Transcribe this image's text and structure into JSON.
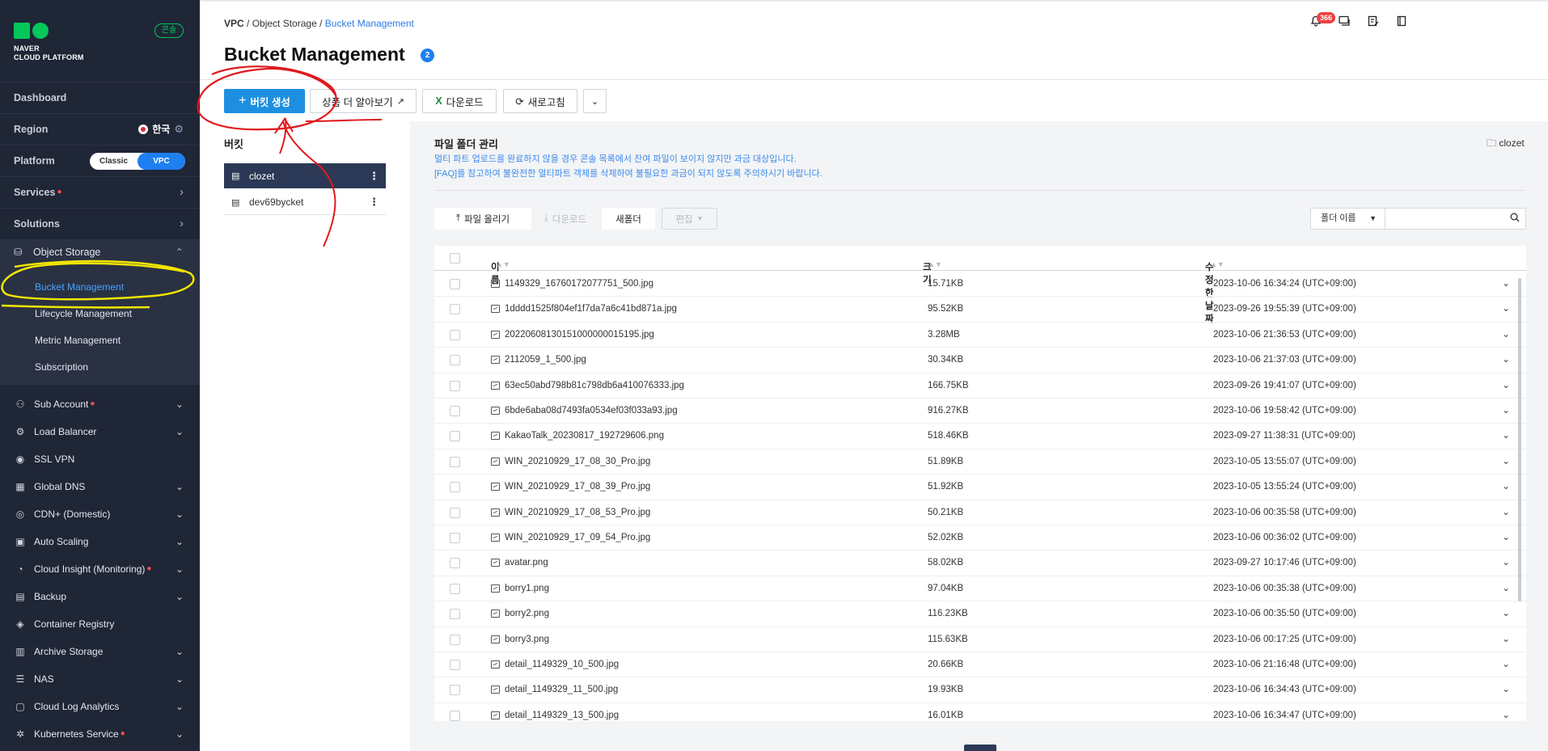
{
  "brand": {
    "line1": "NAVER",
    "line2": "CLOUD PLATFORM",
    "console_badge": "콘솔",
    "accent": "#03c75a"
  },
  "sidebar": {
    "dashboard": "Dashboard",
    "region_label": "Region",
    "region_value": "한국",
    "platform_label": "Platform",
    "platform_options": [
      "Classic",
      "VPC"
    ],
    "platform_selected": "VPC",
    "services": "Services",
    "solutions": "Solutions",
    "object_storage": "Object Storage",
    "object_storage_items": [
      "Bucket Management",
      "Lifecycle Management",
      "Metric Management",
      "Subscription"
    ],
    "active_item": "Bucket Management",
    "products": [
      {
        "label": "Sub Account",
        "icon": "users-icon",
        "dot": true,
        "expand": true
      },
      {
        "label": "Load Balancer",
        "icon": "load-balancer-icon",
        "dot": false,
        "expand": true
      },
      {
        "label": "SSL VPN",
        "icon": "vpn-icon",
        "dot": false,
        "expand": false
      },
      {
        "label": "Global DNS",
        "icon": "dns-icon",
        "dot": false,
        "expand": true
      },
      {
        "label": "CDN+ (Domestic)",
        "icon": "cdn-icon",
        "dot": false,
        "expand": true
      },
      {
        "label": "Auto Scaling",
        "icon": "auto-scaling-icon",
        "dot": false,
        "expand": true
      },
      {
        "label": "Cloud Insight (Monitoring)",
        "icon": "monitoring-icon",
        "dot": true,
        "expand": true
      },
      {
        "label": "Backup",
        "icon": "backup-icon",
        "dot": false,
        "expand": true
      },
      {
        "label": "Container Registry",
        "icon": "registry-icon",
        "dot": false,
        "expand": false
      },
      {
        "label": "Archive Storage",
        "icon": "archive-icon",
        "dot": false,
        "expand": true
      },
      {
        "label": "NAS",
        "icon": "nas-icon",
        "dot": false,
        "expand": true
      },
      {
        "label": "Cloud Log Analytics",
        "icon": "log-icon",
        "dot": false,
        "expand": true
      },
      {
        "label": "Kubernetes Service",
        "icon": "kubernetes-icon",
        "dot": true,
        "expand": true
      }
    ]
  },
  "header": {
    "breadcrumb": [
      "VPC",
      "Object Storage",
      "Bucket Management"
    ],
    "title": "Bucket Management",
    "title_badge": "2",
    "notification_count": "366"
  },
  "toolbar": {
    "create_bucket": "버킷 생성",
    "learn_more": "상품 더 알아보기",
    "download": "다운로드",
    "refresh": "새로고침"
  },
  "buckets": {
    "title": "버킷",
    "items": [
      "clozet",
      "dev69bycket"
    ],
    "selected": "clozet"
  },
  "files": {
    "title": "파일 폴더 관리",
    "notice1": "멀티 파트 업로드를 완료하지 않을 경우 콘솔 목록에서 잔여 파일이 보이지 않지만 과금 대상입니다.",
    "notice2": "[FAQ]를 참고하여 불완전한 멀티파트 객체를 삭제하여 불필요한 과금이 되지 않도록 주의하시기 바랍니다.",
    "current_folder": "clozet",
    "upload": "파일 올리기",
    "download": "다운로드",
    "new_folder": "새폴더",
    "edit": "편집",
    "search_field": "폴더 이름",
    "search_placeholder": "",
    "columns": [
      "이름",
      "크기",
      "수정한 날짜"
    ],
    "rows": [
      {
        "name": "1149329_16760172077751_500.jpg",
        "size": "15.71KB",
        "date": "2023-10-06 16:34:24 (UTC+09:00)"
      },
      {
        "name": "1dddd1525f804ef1f7da7a6c41bd871a.jpg",
        "size": "95.52KB",
        "date": "2023-09-26 19:55:39 (UTC+09:00)"
      },
      {
        "name": "20220608130151000000015195.jpg",
        "size": "3.28MB",
        "date": "2023-10-06 21:36:53 (UTC+09:00)"
      },
      {
        "name": "2112059_1_500.jpg",
        "size": "30.34KB",
        "date": "2023-10-06 21:37:03 (UTC+09:00)"
      },
      {
        "name": "63ec50abd798b81c798db6a410076333.jpg",
        "size": "166.75KB",
        "date": "2023-09-26 19:41:07 (UTC+09:00)"
      },
      {
        "name": "6bde6aba08d7493fa0534ef03f033a93.jpg",
        "size": "916.27KB",
        "date": "2023-10-06 19:58:42 (UTC+09:00)"
      },
      {
        "name": "KakaoTalk_20230817_192729606.png",
        "size": "518.46KB",
        "date": "2023-09-27 11:38:31 (UTC+09:00)"
      },
      {
        "name": "WIN_20210929_17_08_30_Pro.jpg",
        "size": "51.89KB",
        "date": "2023-10-05 13:55:07 (UTC+09:00)"
      },
      {
        "name": "WIN_20210929_17_08_39_Pro.jpg",
        "size": "51.92KB",
        "date": "2023-10-05 13:55:24 (UTC+09:00)"
      },
      {
        "name": "WIN_20210929_17_08_53_Pro.jpg",
        "size": "50.21KB",
        "date": "2023-10-06 00:35:58 (UTC+09:00)"
      },
      {
        "name": "WIN_20210929_17_09_54_Pro.jpg",
        "size": "52.02KB",
        "date": "2023-10-06 00:36:02 (UTC+09:00)"
      },
      {
        "name": "avatar.png",
        "size": "58.02KB",
        "date": "2023-09-27 10:17:46 (UTC+09:00)"
      },
      {
        "name": "borry1.png",
        "size": "97.04KB",
        "date": "2023-10-06 00:35:38 (UTC+09:00)"
      },
      {
        "name": "borry2.png",
        "size": "116.23KB",
        "date": "2023-10-06 00:35:50 (UTC+09:00)"
      },
      {
        "name": "borry3.png",
        "size": "115.63KB",
        "date": "2023-10-06 00:17:25 (UTC+09:00)"
      },
      {
        "name": "detail_1149329_10_500.jpg",
        "size": "20.66KB",
        "date": "2023-10-06 21:16:48 (UTC+09:00)"
      },
      {
        "name": "detail_1149329_11_500.jpg",
        "size": "19.93KB",
        "date": "2023-10-06 16:34:43 (UTC+09:00)"
      },
      {
        "name": "detail_1149329_13_500.jpg",
        "size": "16.01KB",
        "date": "2023-10-06 16:34:47 (UTC+09:00)"
      }
    ]
  },
  "annotation_colors": {
    "red": "#e0191d",
    "yellow": "#f2e600"
  }
}
